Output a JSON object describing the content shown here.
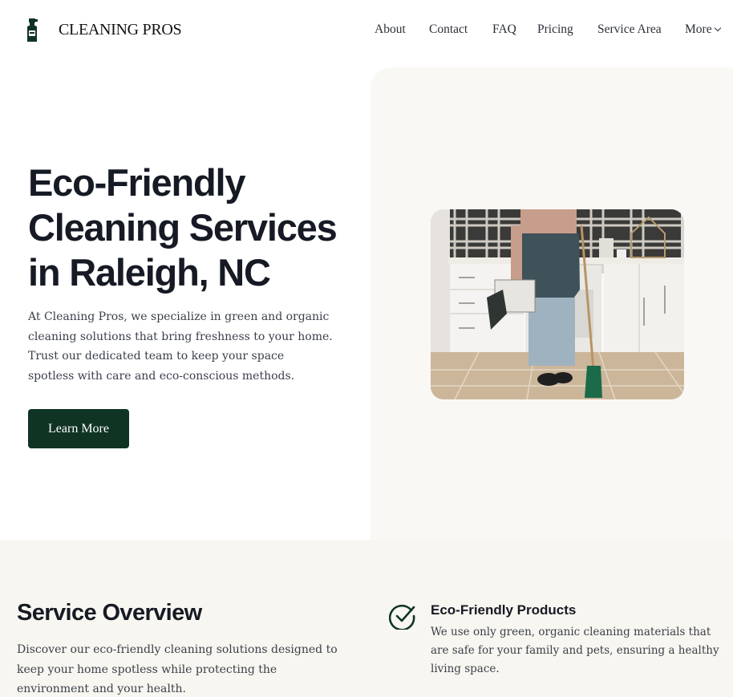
{
  "brand": {
    "name": "CLEANING PROS",
    "logo_icon": "spray-bottle-icon",
    "primary_color": "#0f3423"
  },
  "nav": {
    "items": [
      "About",
      "Contact",
      "FAQ",
      "Pricing",
      "Service Area"
    ],
    "more_label": "More",
    "more_icon": "chevron-down-icon"
  },
  "hero": {
    "title_line1": "Eco-Friendly",
    "title_line2": "Cleaning Services",
    "title_line3": "in Raleigh, NC",
    "description": "At Cleaning Pros, we specialize in green and organic cleaning solutions that bring freshness to your home. Trust our dedicated team to keep your space spotless with care and eco-conscious methods.",
    "cta_label": "Learn More",
    "panel_color": "#faf8f4"
  },
  "overview": {
    "title": "Service Overview",
    "description": "Discover our eco-friendly cleaning solutions designed to keep your home spotless while protecting the environment and your health.",
    "features": [
      {
        "icon": "check-circle-icon",
        "title": "Eco-Friendly Products",
        "description": "We use only green, organic cleaning materials that are safe for your family and pets, ensuring a healthy living space."
      }
    ],
    "background_color": "#f8f6f0"
  }
}
